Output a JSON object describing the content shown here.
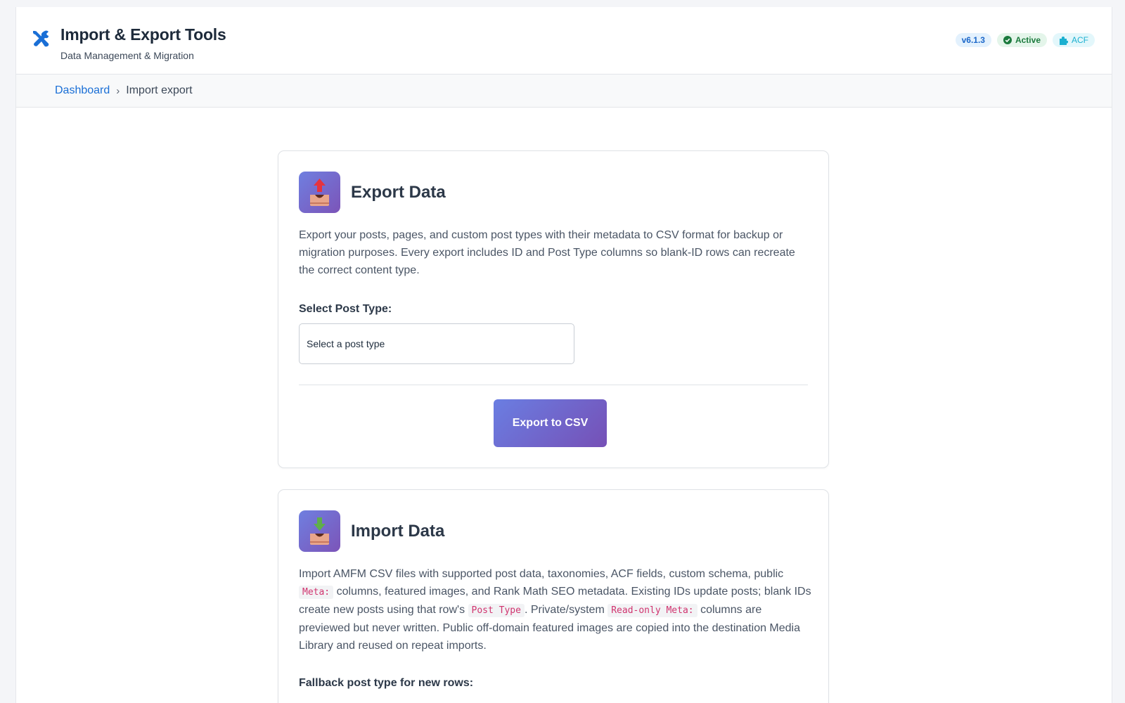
{
  "header": {
    "title": "Import & Export Tools",
    "subtitle": "Data Management & Migration",
    "logo_icon": "tools-icon",
    "badges": {
      "version": "v6.1.3",
      "status": "Active",
      "plugin": "ACF"
    }
  },
  "breadcrumb": {
    "home": "Dashboard",
    "separator": "›",
    "current": "Import export"
  },
  "export_card": {
    "icon": "export-tray-icon",
    "title": "Export Data",
    "description": "Export your posts, pages, and custom post types with their metadata to CSV format for backup or migration purposes. Every export includes ID and Post Type columns so blank-ID rows can recreate the correct content type.",
    "post_type_label": "Select Post Type:",
    "post_type_value": "Select a post type",
    "button_label": "Export to CSV"
  },
  "import_card": {
    "icon": "import-tray-icon",
    "title": "Import Data",
    "description": {
      "part1": "Import AMFM CSV files with supported post data, taxonomies, ACF fields, custom schema, public ",
      "code1": "Meta:",
      "part2": " columns, featured images, and Rank Math SEO metadata. Existing IDs update posts; blank IDs create new posts using that row's ",
      "code2": "Post Type",
      "part3": ". Private/system ",
      "code3": "Read-only Meta:",
      "part4": " columns are previewed but never written. Public off-domain featured images are copied into the destination Media Library and reused on repeat imports."
    },
    "fallback_label": "Fallback post type for new rows:"
  },
  "colors": {
    "accent_gradient_start": "#6a7ee2",
    "accent_gradient_end": "#7650b6",
    "link": "#1a6fd6",
    "code": "#d1346f"
  }
}
